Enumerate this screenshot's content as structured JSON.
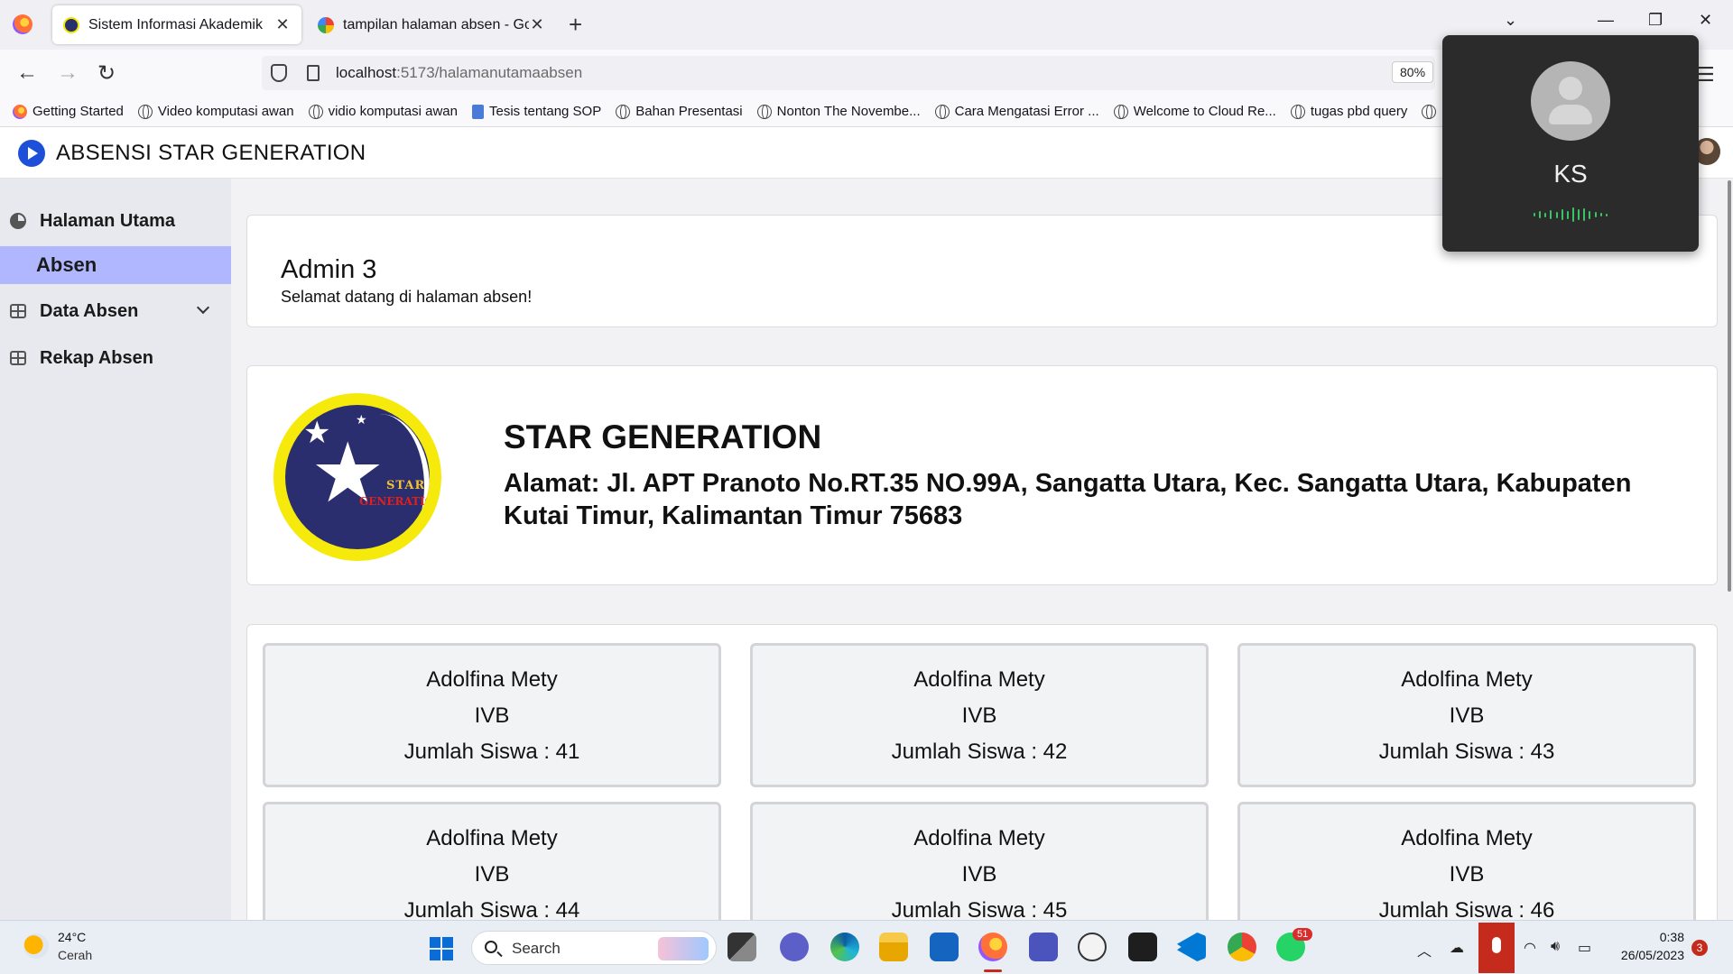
{
  "browser": {
    "tabs": [
      {
        "title": "Sistem Informasi Akademik",
        "active": true
      },
      {
        "title": "tampilan halaman absen - Goo",
        "active": false
      }
    ],
    "url_host": "localhost",
    "url_path": ":5173/halamanutamaabsen",
    "zoom": "80%",
    "bookmarks": [
      {
        "label": "Getting Started",
        "icon": "firefox-icon"
      },
      {
        "label": "Video komputasi awan",
        "icon": "globe-icon"
      },
      {
        "label": "vidio komputasi awan",
        "icon": "globe-icon"
      },
      {
        "label": "Tesis tentang SOP",
        "icon": "document-icon"
      },
      {
        "label": "Bahan Presentasi",
        "icon": "globe-icon"
      },
      {
        "label": "Nonton The Novembe...",
        "icon": "globe-icon"
      },
      {
        "label": "Cara Mengatasi Error ...",
        "icon": "globe-icon"
      },
      {
        "label": "Welcome to Cloud Re...",
        "icon": "globe-icon"
      },
      {
        "label": "tugas pbd query",
        "icon": "globe-icon"
      }
    ]
  },
  "app": {
    "title": "ABSENSI STAR GENERATION",
    "accent_color": "#b0b7ff"
  },
  "sidebar": {
    "items": [
      {
        "label": "Halaman Utama",
        "icon": "pie-chart-icon"
      },
      {
        "label": "Absen",
        "active": true
      },
      {
        "label": "Data Absen",
        "icon": "table-icon",
        "has_dropdown": true
      },
      {
        "label": "Rekap Absen",
        "icon": "table-icon"
      }
    ]
  },
  "welcome": {
    "name": "Admin 3",
    "subtitle": "Selamat datang di halaman absen!"
  },
  "school": {
    "name": "STAR GENERATION",
    "address": "Alamat: Jl. APT Pranoto No.RT.35 NO.99A, Sangatta Utara, Kec. Sangatta Utara, Kabupaten Kutai Timur, Kalimantan Timur 75683",
    "logo_text_1": "STAR",
    "logo_text_2": "GENERATION"
  },
  "classes": [
    {
      "teacher": "Adolfina Mety",
      "class": "IVB",
      "count": "Jumlah Siswa : 41"
    },
    {
      "teacher": "Adolfina Mety",
      "class": "IVB",
      "count": "Jumlah Siswa : 42"
    },
    {
      "teacher": "Adolfina Mety",
      "class": "IVB",
      "count": "Jumlah Siswa : 43"
    },
    {
      "teacher": "Adolfina Mety",
      "class": "IVB",
      "count": "Jumlah Siswa : 44"
    },
    {
      "teacher": "Adolfina Mety",
      "class": "IVB",
      "count": "Jumlah Siswa : 45"
    },
    {
      "teacher": "Adolfina Mety",
      "class": "IVB",
      "count": "Jumlah Siswa : 46"
    }
  ],
  "call": {
    "initials": "KS"
  },
  "taskbar": {
    "temperature": "24°C",
    "condition": "Cerah",
    "search_placeholder": "Search",
    "whatsapp_badge": "51",
    "time": "0:38",
    "date": "26/05/2023",
    "notifications": "3"
  }
}
